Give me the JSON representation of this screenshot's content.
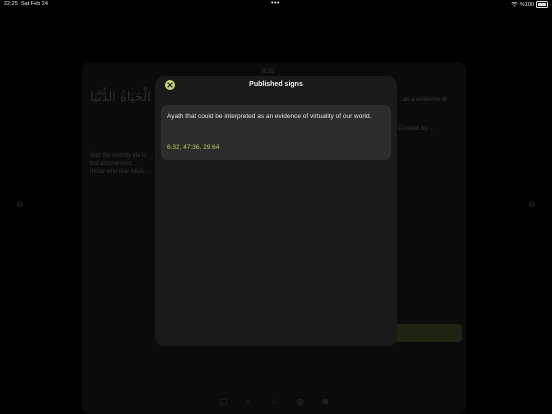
{
  "status_bar": {
    "time": "22:25",
    "date": "Sat Feb 24",
    "dots": "•••",
    "wifi_icon": "wifi-icon",
    "battery": "%100"
  },
  "background": {
    "time": "6:32",
    "right_line1": "...as a evidence of",
    "right_line2": "Created by: ...",
    "left_line1": "...",
    "left_line2": "And the worldly life is ... but amusement ... those who fear Allah..."
  },
  "modal": {
    "title": "Published signs",
    "close_icon": "close-icon",
    "card": {
      "text": "Ayath that could be interpreted as an evidence of virtuality of our world.",
      "refs": "6:32, 47:36, 29:64"
    }
  },
  "colors": {
    "accent": "#c5d86d",
    "ref_text": "#b8cc5a",
    "modal_bg": "#1a1a1a",
    "card_bg": "#2c2c2c"
  }
}
